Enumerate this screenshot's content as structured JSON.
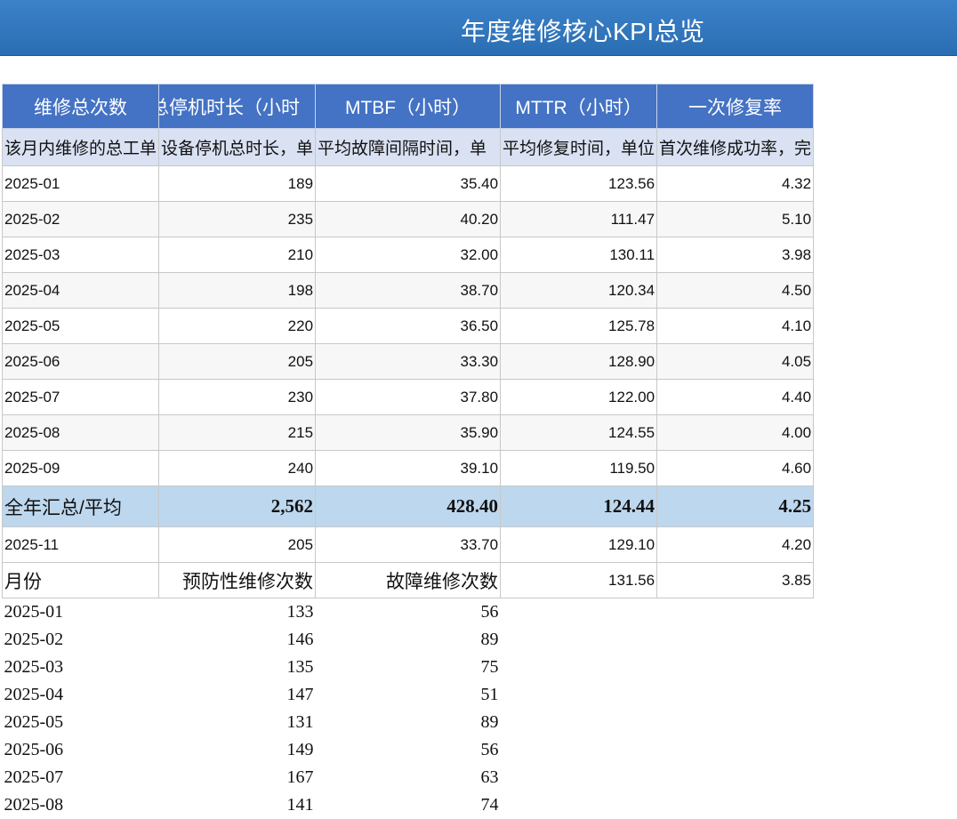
{
  "title": "年度维修核心KPI总览",
  "headers": [
    "维修总次数",
    "总停机时长（小时",
    "MTBF（小时）",
    "MTTR（小时）",
    "一次修复率"
  ],
  "descriptions": [
    "该月内维修的总工单",
    "设备停机总时长，单",
    "平均故障间隔时间，单",
    "平均修复时间，单位",
    "首次维修成功率，完"
  ],
  "rows": [
    {
      "month": "2025-01",
      "a": "189",
      "b": "35.40",
      "c": "123.56",
      "d": "4.32"
    },
    {
      "month": "2025-02",
      "a": "235",
      "b": "40.20",
      "c": "111.47",
      "d": "5.10"
    },
    {
      "month": "2025-03",
      "a": "210",
      "b": "32.00",
      "c": "130.11",
      "d": "3.98"
    },
    {
      "month": "2025-04",
      "a": "198",
      "b": "38.70",
      "c": "120.34",
      "d": "4.50"
    },
    {
      "month": "2025-05",
      "a": "220",
      "b": "36.50",
      "c": "125.78",
      "d": "4.10"
    },
    {
      "month": "2025-06",
      "a": "205",
      "b": "33.30",
      "c": "128.90",
      "d": "4.05"
    },
    {
      "month": "2025-07",
      "a": "230",
      "b": "37.80",
      "c": "122.00",
      "d": "4.40"
    },
    {
      "month": "2025-08",
      "a": "215",
      "b": "35.90",
      "c": "124.55",
      "d": "4.00"
    },
    {
      "month": "2025-09",
      "a": "240",
      "b": "39.10",
      "c": "119.50",
      "d": "4.60"
    }
  ],
  "total": {
    "label": "全年汇总/平均",
    "a": "2,562",
    "b": "428.40",
    "c": "124.44",
    "d": "4.25"
  },
  "after_total": {
    "month": "2025-11",
    "a": "205",
    "b": "33.70",
    "c": "129.10",
    "d": "4.20"
  },
  "sub_header": {
    "month": "月份",
    "preventive": "预防性维修次数",
    "fault": "故障维修次数",
    "c": "131.56",
    "d": "3.85"
  },
  "maintenance_rows": [
    {
      "month": "2025-01",
      "preventive": "133",
      "fault": "56"
    },
    {
      "month": "2025-02",
      "preventive": "146",
      "fault": "89"
    },
    {
      "month": "2025-03",
      "preventive": "135",
      "fault": "75"
    },
    {
      "month": "2025-04",
      "preventive": "147",
      "fault": "51"
    },
    {
      "month": "2025-05",
      "preventive": "131",
      "fault": "89"
    },
    {
      "month": "2025-06",
      "preventive": "149",
      "fault": "56"
    },
    {
      "month": "2025-07",
      "preventive": "167",
      "fault": "63"
    },
    {
      "month": "2025-08",
      "preventive": "141",
      "fault": "74"
    }
  ]
}
